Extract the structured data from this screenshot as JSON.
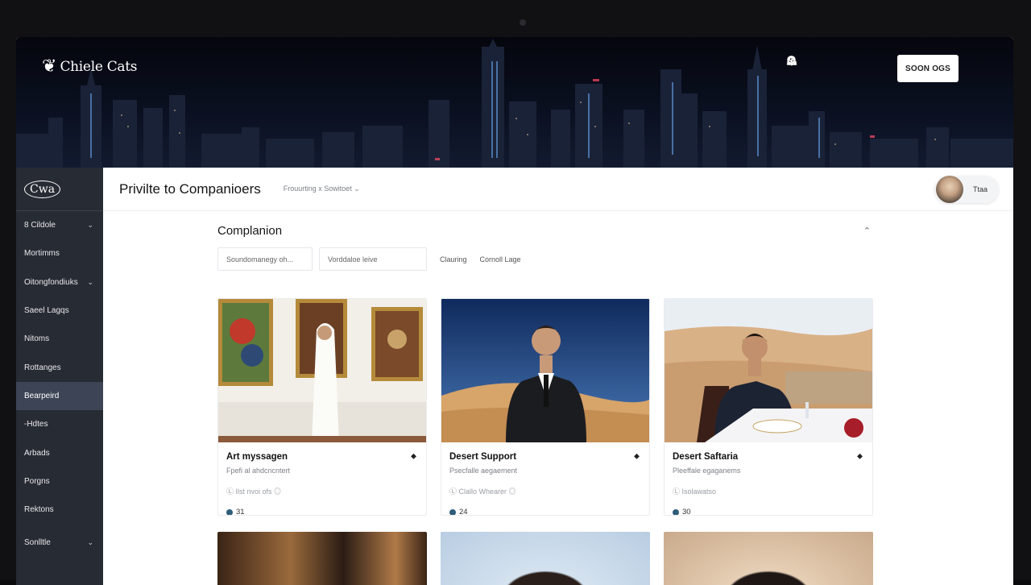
{
  "header": {
    "logo_glyph": "❦",
    "brand": "Chiele Cats",
    "button_label": "SOON OGS",
    "icons": [
      "share-icon",
      "bell-icon",
      "search-icon",
      "chevron-down-icon"
    ]
  },
  "sidebar": {
    "logo_text": "Cwa",
    "items": [
      {
        "label": "8 Cildole",
        "chevron": "⌄"
      },
      {
        "label": "Mortimms",
        "chevron": ""
      },
      {
        "label": "Oitongfondiuks",
        "chevron": "⌄"
      },
      {
        "label": "Saeel Lagqs",
        "chevron": ""
      },
      {
        "label": "Nitoms",
        "chevron": ""
      },
      {
        "label": "Rottanges",
        "chevron": ""
      },
      {
        "label": "Bearpeird",
        "chevron": "",
        "active": true
      },
      {
        "label": "-Hdtes",
        "chevron": ""
      },
      {
        "label": "Arbads",
        "chevron": ""
      },
      {
        "label": "Porgns",
        "chevron": ""
      },
      {
        "label": "Rektons",
        "chevron": ""
      },
      {
        "label": "Sonlltle",
        "chevron": "⌄"
      }
    ]
  },
  "topbar": {
    "title": "Privilte to Companioers",
    "filter": "Frouurting x Sowitoet ⌄",
    "profile_label": "Ttaa"
  },
  "section": {
    "title": "Complanion",
    "collapse": "⌃",
    "search_placeholder": "Soundomanegy oh...",
    "input2_placeholder": "Vorddaloe leive",
    "tag1": "Clauring",
    "tag2": "Cornoll Lage"
  },
  "cards": [
    {
      "title": "Art myssagen",
      "subtitle": "Fpefi al ahdcncntert",
      "location": "Ⓛ Ilst nvoi ofs ◎",
      "count": "31"
    },
    {
      "title": "Desert Support",
      "subtitle": "Psecfalle aegaement",
      "location": "Ⓛ Clallo Whearer ◎",
      "count": "24"
    },
    {
      "title": "Desert Saftaria",
      "subtitle": "Pleeffale egaganems",
      "location": "Ⓛ Isolawatso",
      "count": "30"
    }
  ],
  "colors": {
    "sidebar_bg": "#272b33",
    "sidebar_active": "#3c4455",
    "accent": "#2f5d7a"
  }
}
